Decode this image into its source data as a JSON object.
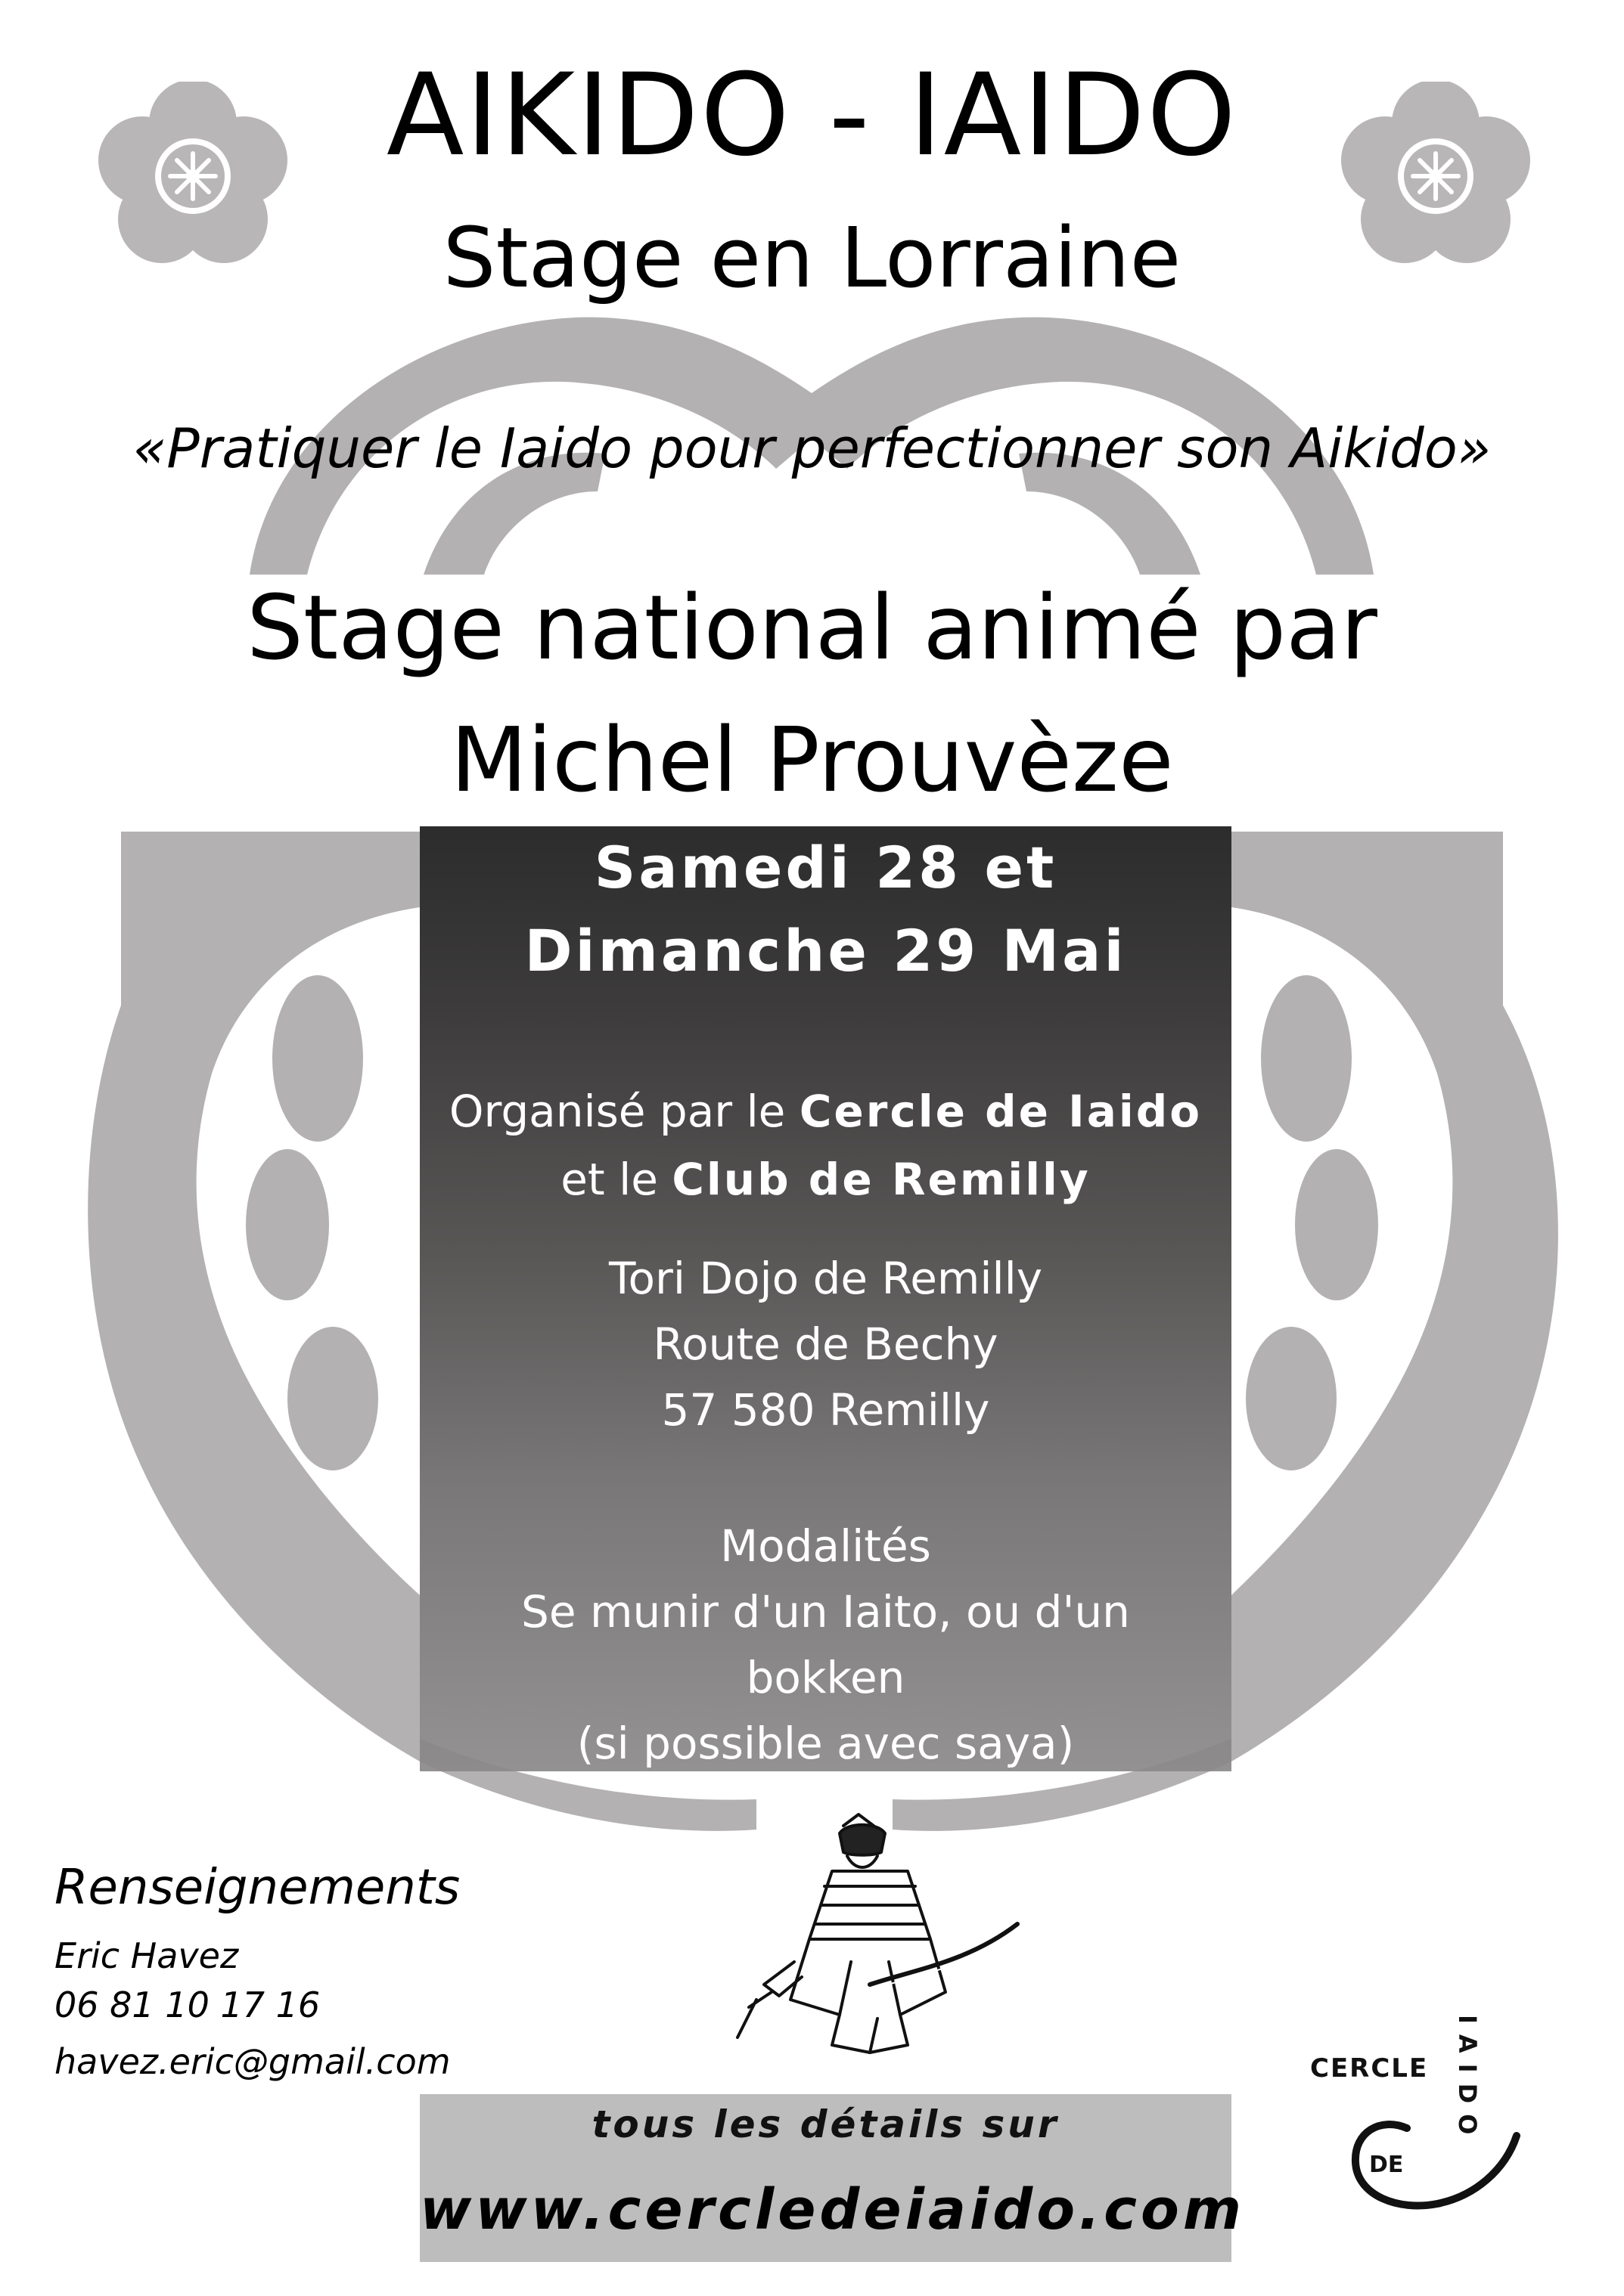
{
  "header": {
    "title": "AIKIDO - IAIDO",
    "subtitle": "Stage en Lorraine",
    "quote": "«Pratiquer le Iaido pour perfectionner son Aikido»"
  },
  "announcement": {
    "line1": "Stage national animé par",
    "line2": "Michel Prouvèze"
  },
  "panel": {
    "date_line1": "Samedi 28 et",
    "date_line2": "Dimanche 29 Mai",
    "organizer_prefix1": "Organisé par le ",
    "organizer_name1": "Cercle de Iaido",
    "organizer_prefix2": "et le ",
    "organizer_name2": "Club de Remilly",
    "address_line1": "Tori Dojo de Remilly",
    "address_line2": "Route de Bechy",
    "address_line3": "57 580 Remilly",
    "modalities_title": "Modalités",
    "modalities_line1": "Se munir d'un Iaito, ou d'un",
    "modalities_line2": "bokken",
    "modalities_line3": "(si possible avec saya)"
  },
  "contact": {
    "heading": "Renseignements",
    "name": "Eric Havez",
    "phone": "06 81 10 17 16",
    "email": "havez.eric@gmail.com"
  },
  "footer": {
    "label": "tous les détails sur",
    "url": "www.cercledeiaido.com"
  },
  "logo": {
    "top_text": "CERCLE",
    "bottom_text": "DE",
    "vertical_text": "IAIDO"
  },
  "icons": {
    "flower_left": "sakura-crest-icon",
    "flower_right": "sakura-crest-icon",
    "emblem": "crest-emblem-icon",
    "samurai": "samurai-illustration-icon"
  },
  "colors": {
    "emblem_gray": "#b3b1b1",
    "panel_dark": "#1a1a1a",
    "footer_gray": "#bdbdbd"
  }
}
